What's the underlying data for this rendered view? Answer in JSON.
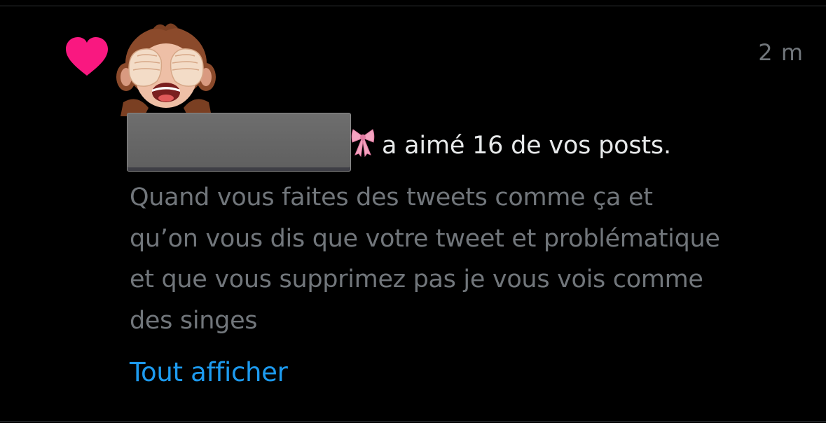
{
  "notification": {
    "type_icon": "heart-icon",
    "accent_color": "#f91880",
    "avatar_icon": "see-no-evil-monkey-icon",
    "timestamp": "2 m",
    "username": "",
    "username_suffix_icon": "pink-bow-icon",
    "action_text": "a aimé 16 de vos posts.",
    "tweet_text": "Quand vous faites des tweets comme ça et\nqu’on vous dis que votre tweet et problématique\net que vous supprimez pas je vous vois comme\ndes singes",
    "show_all_label": "Tout afficher",
    "link_color": "#1d9bf0"
  }
}
